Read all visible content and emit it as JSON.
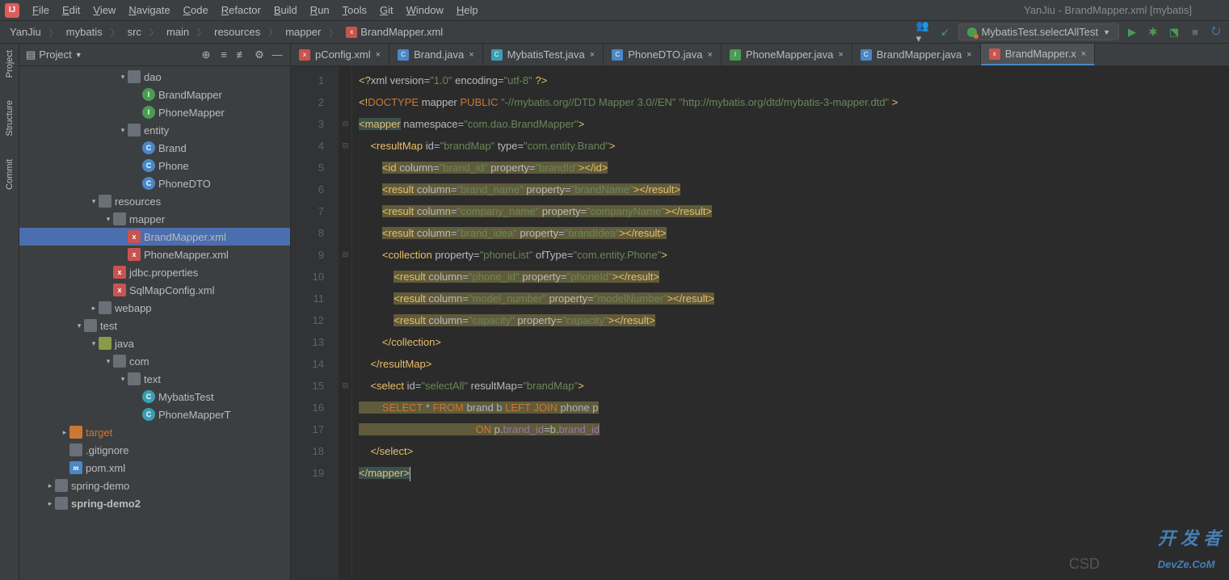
{
  "window_title": "YanJiu - BrandMapper.xml [mybatis]",
  "menus": [
    "File",
    "Edit",
    "View",
    "Navigate",
    "Code",
    "Refactor",
    "Build",
    "Run",
    "Tools",
    "Git",
    "Window",
    "Help"
  ],
  "breadcrumbs": [
    "YanJiu",
    "mybatis",
    "src",
    "main",
    "resources",
    "mapper",
    "BrandMapper.xml"
  ],
  "run_config": "MybatisTest.selectAllTest",
  "project": {
    "title": "Project"
  },
  "tree": [
    {
      "indent": 5,
      "arrow": "▾",
      "icon": "folder",
      "label": "dao"
    },
    {
      "indent": 6,
      "arrow": "",
      "icon": "green",
      "label": "BrandMapper"
    },
    {
      "indent": 6,
      "arrow": "",
      "icon": "green",
      "label": "PhoneMapper"
    },
    {
      "indent": 5,
      "arrow": "▾",
      "icon": "folder",
      "label": "entity"
    },
    {
      "indent": 6,
      "arrow": "",
      "icon": "blue",
      "label": "Brand"
    },
    {
      "indent": 6,
      "arrow": "",
      "icon": "blue",
      "label": "Phone"
    },
    {
      "indent": 6,
      "arrow": "",
      "icon": "blue",
      "label": "PhoneDTO"
    },
    {
      "indent": 3,
      "arrow": "▾",
      "icon": "folder",
      "label": "resources"
    },
    {
      "indent": 4,
      "arrow": "▾",
      "icon": "folder",
      "label": "mapper"
    },
    {
      "indent": 5,
      "arrow": "",
      "icon": "xml",
      "label": "BrandMapper.xml",
      "selected": true
    },
    {
      "indent": 5,
      "arrow": "",
      "icon": "xml",
      "label": "PhoneMapper.xml"
    },
    {
      "indent": 4,
      "arrow": "",
      "icon": "xml",
      "label": "jdbc.properties"
    },
    {
      "indent": 4,
      "arrow": "",
      "icon": "xml",
      "label": "SqlMapConfig.xml"
    },
    {
      "indent": 3,
      "arrow": "▸",
      "icon": "folder",
      "label": "webapp"
    },
    {
      "indent": 2,
      "arrow": "▾",
      "icon": "folder",
      "label": "test"
    },
    {
      "indent": 3,
      "arrow": "▾",
      "icon": "folder-g",
      "label": "java"
    },
    {
      "indent": 4,
      "arrow": "▾",
      "icon": "folder",
      "label": "com"
    },
    {
      "indent": 5,
      "arrow": "▾",
      "icon": "folder",
      "label": "text"
    },
    {
      "indent": 6,
      "arrow": "",
      "icon": "teal",
      "label": "MybatisTest"
    },
    {
      "indent": 6,
      "arrow": "",
      "icon": "teal",
      "label": "PhoneMapperT"
    },
    {
      "indent": 1,
      "arrow": "▸",
      "icon": "folder-r",
      "label": "target",
      "orange": true
    },
    {
      "indent": 1,
      "arrow": "",
      "icon": "file",
      "label": ".gitignore"
    },
    {
      "indent": 1,
      "arrow": "",
      "icon": "maven",
      "label": "pom.xml"
    },
    {
      "indent": 0,
      "arrow": "▸",
      "icon": "folder",
      "label": "spring-demo"
    },
    {
      "indent": 0,
      "arrow": "▸",
      "icon": "folder",
      "label": "spring-demo2",
      "bold": true
    }
  ],
  "tabs": [
    {
      "icon": "xml",
      "label": "pConfig.xml"
    },
    {
      "icon": "blue",
      "label": "Brand.java"
    },
    {
      "icon": "teal",
      "label": "MybatisTest.java"
    },
    {
      "icon": "blue",
      "label": "PhoneDTO.java"
    },
    {
      "icon": "green",
      "label": "PhoneMapper.java"
    },
    {
      "icon": "blue",
      "label": "BrandMapper.java"
    },
    {
      "icon": "xml",
      "label": "BrandMapper.x",
      "active": true
    }
  ],
  "code": {
    "lines": 19,
    "l1": "<?xml version=\"1.0\" encoding=\"utf-8\" ?>",
    "l2": "<!DOCTYPE mapper PUBLIC \"-//mybatis.org//DTD Mapper 3.0//EN\" \"http://mybatis.org/dtd/mybatis-3-mapper.dtd\" >",
    "l3_tag": "mapper",
    "l3_ns": "com.dao.BrandMapper",
    "l4_id": "brandMap",
    "l4_type": "com.entity.Brand",
    "l5_c": "brand_id",
    "l5_p": "brandId",
    "l6_c": "brand_name",
    "l6_p": "brandName",
    "l7_c": "company_name",
    "l7_p": "companyName",
    "l8_c": "brand_idea",
    "l8_p": "brandIdea",
    "l9_p": "phoneList",
    "l9_t": "com.entity.Phone",
    "l10_c": "phone_id",
    "l10_p": "phoneId",
    "l11_c": "model_number",
    "l11_p": "modelNumber",
    "l12_c": "capacity",
    "l12_p": "capacity",
    "l15_id": "selectAll",
    "l15_rm": "brandMap",
    "l16": "SELECT * FROM brand b LEFT JOIN phone p",
    "l17": "ON p.brand_id=b.brand_id"
  },
  "watermark": "DevZe.CoM",
  "watermark_cn": "开 发 者",
  "watermark2": "CSD"
}
